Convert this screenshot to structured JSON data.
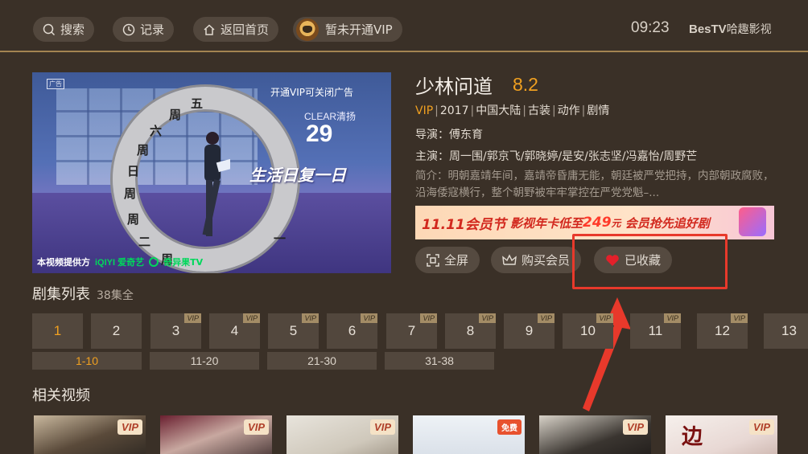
{
  "topbar": {
    "search_label": "搜索",
    "history_label": "记录",
    "home_label": "返回首页",
    "vip_label": "暂未开通VIP",
    "clock": "09:23",
    "brand_en": "BesTV",
    "brand_cn": "哈趣影视"
  },
  "player": {
    "ad_tag": "广告",
    "ad_close_tip": "开通VIP可关闭广告",
    "ad_brand": "CLEAR清扬",
    "ad_number": "29",
    "ad_slogan": "生活日复一日",
    "ring_chars": [
      "五",
      "周",
      "六",
      "周",
      "日",
      "周",
      "周",
      "二",
      "周",
      "一"
    ],
    "provider_label": "本视频提供方",
    "provider_iqiyi": "iQIYI 爱奇艺",
    "provider_tv": "奇异果TV"
  },
  "info": {
    "title": "少林问道",
    "score": "8.2",
    "tags": [
      "VIP",
      "2017",
      "中国大陆",
      "古装",
      "动作",
      "剧情"
    ],
    "director": "导演：傅东育",
    "cast": "主演：周一围/郭京飞/郭晓婷/是安/张志坚/冯嘉怡/周野芒",
    "synopsis": "简介：明朝嘉靖年间，嘉靖帝昏庸无能，朝廷被严党把持，内部朝政腐败，沿海倭寇横行，整个朝野被牢牢掌控在严党党魁–..."
  },
  "promo": {
    "part1": "11.11会员节",
    "part2": "影视年卡低至",
    "price": "249",
    "unit": "元",
    "part3": "会员抢先追好剧"
  },
  "actions": {
    "fullscreen": "全屏",
    "buy_vip": "购买会员",
    "favorited": "已收藏"
  },
  "episodes": {
    "section_title": "剧集列表",
    "total": "38集全",
    "items": [
      {
        "num": "1",
        "vip": false
      },
      {
        "num": "2",
        "vip": false
      },
      {
        "num": "3",
        "vip": true
      },
      {
        "num": "4",
        "vip": true
      },
      {
        "num": "5",
        "vip": true
      },
      {
        "num": "6",
        "vip": true
      },
      {
        "num": "7",
        "vip": true
      },
      {
        "num": "8",
        "vip": true
      },
      {
        "num": "9",
        "vip": true
      },
      {
        "num": "10",
        "vip": true
      },
      {
        "num": "11",
        "vip": true
      },
      {
        "num": "12",
        "vip": true
      },
      {
        "num": "13",
        "vip": false
      }
    ],
    "vip_badge": "VIP",
    "ranges": [
      "1-10",
      "11-20",
      "21-30",
      "31-38"
    ]
  },
  "related": {
    "section_title": "相关视频",
    "items": [
      {
        "badge": "VIP"
      },
      {
        "badge": "VIP"
      },
      {
        "badge": "VIP"
      },
      {
        "badge": "免费"
      },
      {
        "badge": "VIP"
      },
      {
        "badge": "VIP",
        "overlay_text": "边"
      }
    ]
  },
  "colors": {
    "background": "#3a3027",
    "accent_orange": "#f0a020",
    "highlight_red": "#e8392b"
  }
}
